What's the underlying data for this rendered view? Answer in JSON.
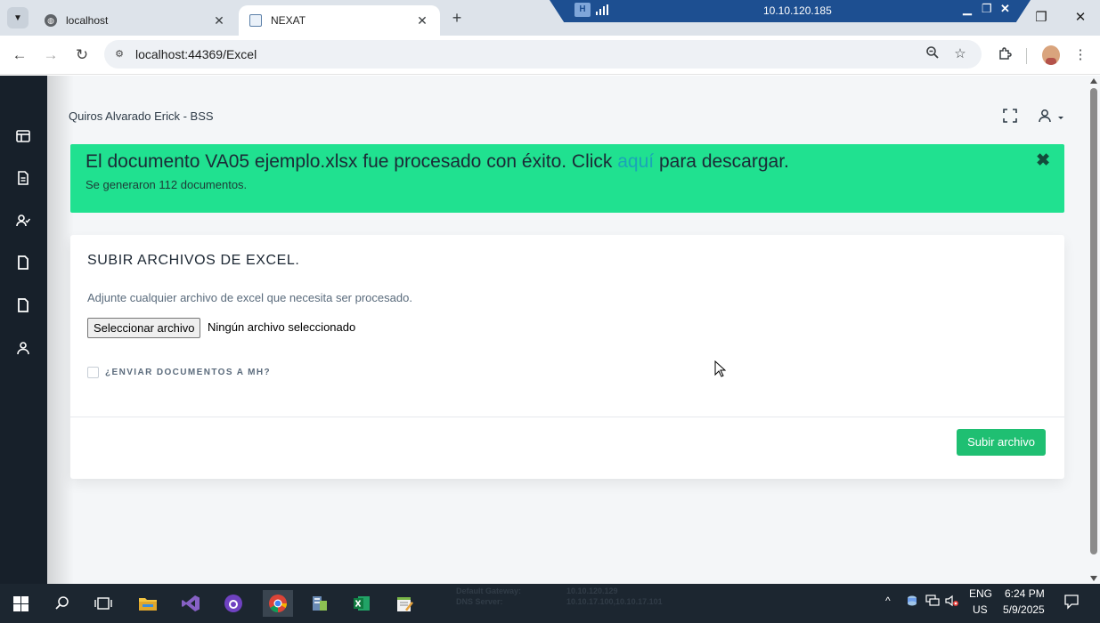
{
  "browser": {
    "tabs": [
      {
        "title": "localhost",
        "active": false
      },
      {
        "title": "NEXAT",
        "active": true
      }
    ],
    "url": "localhost:44369/Excel",
    "remote_ip": "10.10.120.185"
  },
  "page": {
    "user_name": "Quiros Alvarado Erick - BSS",
    "alert": {
      "prefix": "El documento VA05 ejemplo.xlsx fue procesado con éxito. Click ",
      "link": "aquí",
      "suffix": " para descargar.",
      "subtitle": "Se generaron 112 documentos.",
      "close": "✖"
    },
    "card": {
      "title": "SUBIR ARCHIVOS DE EXCEL.",
      "description": "Adjunte cualquier archivo de excel que necesita ser procesado.",
      "file_button": "Seleccionar archivo",
      "file_status": "Ningún archivo seleccionado",
      "checkbox_label": "¿ENVIAR DOCUMENTOS A MH?",
      "checkbox_checked": false,
      "submit": "Subir archivo"
    },
    "colors": {
      "alert_bg": "#20e190",
      "submit_bg": "#1fbf72",
      "sidebar_bg": "#17202a",
      "link": "#1aa4b8"
    }
  },
  "sidebar_icons": [
    "layout-icon",
    "document-icon",
    "user-check-icon",
    "file-icon",
    "file-icon-2",
    "user-icon"
  ],
  "taskbar": {
    "overlay_left_labels": [
      "Default Gateway:",
      "DNS Server:"
    ],
    "overlay_right_values": [
      "10.10.120.129",
      "10.10.17.100,10.10.17.101"
    ],
    "language": "ENG",
    "region": "US",
    "time": "6:24 PM",
    "date": "5/9/2025"
  }
}
